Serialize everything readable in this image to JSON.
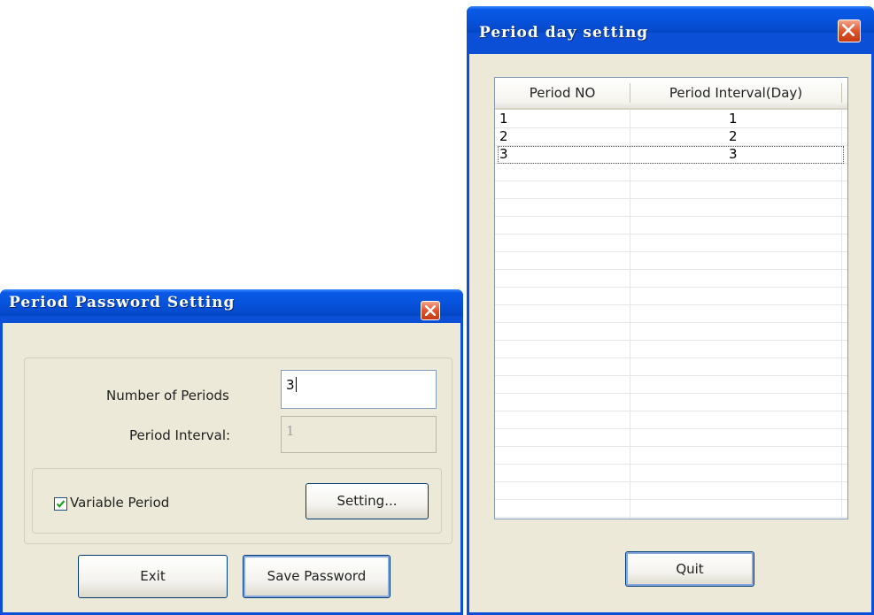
{
  "pwd_dialog": {
    "title": "Period Password Setting",
    "num_periods_label": "Number of Periods",
    "num_periods_value": "3",
    "interval_label": "Period Interval:",
    "interval_value": "1",
    "variable_period_label": "Variable Period",
    "variable_period_checked": true,
    "setting_button": "Setting...",
    "exit_button": "Exit",
    "save_button": "Save Password"
  },
  "day_dialog": {
    "title": "Period day setting",
    "columns": [
      "Period NO",
      "Period Interval(Day)"
    ],
    "rows": [
      {
        "no": "1",
        "interval": "1"
      },
      {
        "no": "2",
        "interval": "2"
      },
      {
        "no": "3",
        "interval": "3"
      }
    ],
    "quit_button": "Quit"
  },
  "colors": {
    "titlebar": "#0652dc",
    "client": "#ece9d8",
    "close_button": "#e0542a",
    "check_mark": "#21a121"
  }
}
